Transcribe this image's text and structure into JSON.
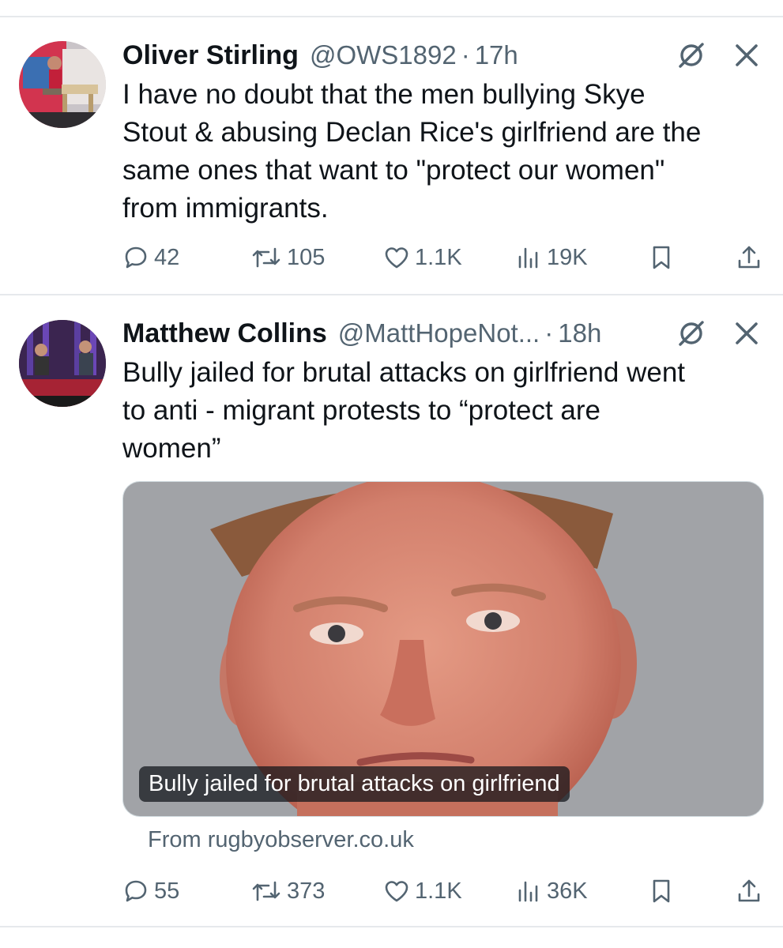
{
  "tweets": [
    {
      "name": "Oliver Stirling",
      "handle": "@OWS1892",
      "dot": "·",
      "time": "17h",
      "text_lines": [
        "I have no doubt that the men bullying Skye",
        "Stout & abusing Declan Rice's girlfriend are the",
        "same ones that want to \"protect our women\"",
        "from immigrants."
      ],
      "replies": "42",
      "retweets": "105",
      "likes": "1.1K",
      "views": "19K"
    },
    {
      "name": "Matthew Collins",
      "handle": "@MattHopeNot...",
      "dot": "·",
      "time": "18h",
      "text_lines": [
        "Bully jailed for brutal attacks on girlfriend went",
        "to anti - migrant protests to “protect are",
        "women”"
      ],
      "card_caption": "Bully jailed for brutal attacks on girlfriend",
      "card_source": "From rugbyobserver.co.uk",
      "replies": "55",
      "retweets": "373",
      "likes": "1.1K",
      "views": "36K"
    }
  ],
  "icons": {
    "grok": "grok-icon",
    "close": "close-icon",
    "reply": "reply-icon",
    "retweet": "retweet-icon",
    "like": "heart-icon",
    "views": "views-icon",
    "bookmark": "bookmark-icon",
    "share": "share-icon"
  },
  "colors": {
    "text": "#0f1419",
    "secondary": "#536471",
    "divider": "#e6e9ec"
  }
}
